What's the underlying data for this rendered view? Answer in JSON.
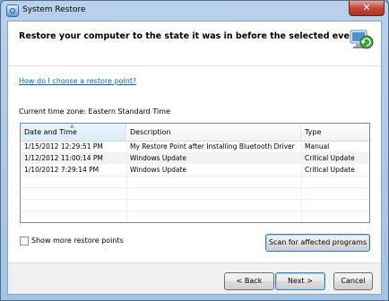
{
  "window": {
    "title": "System Restore",
    "close_glyph": "✕"
  },
  "header": {
    "title": "Restore your computer to the state it was in before the selected event",
    "icon": "system-restore-icon"
  },
  "help_link": "How do I choose a restore point?",
  "timezone_label": "Current time zone: Eastern Standard Time",
  "table": {
    "columns": [
      "Date and Time",
      "Description",
      "Type"
    ],
    "rows": [
      {
        "date": "1/15/2012 12:29:51 PM",
        "description": "My Restore Point after Installing Bluetooth Driver",
        "type": "Manual"
      },
      {
        "date": "1/12/2012 11:00:14 PM",
        "description": "Windows Update",
        "type": "Critical Update"
      },
      {
        "date": "1/10/2012 7:29:14 PM",
        "description": "Windows Update",
        "type": "Critical Update"
      }
    ]
  },
  "show_more": {
    "label": "Show more restore points",
    "checked": false
  },
  "buttons": {
    "scan": "Scan for affected programs",
    "back": "< Back",
    "next": "Next >",
    "cancel": "Cancel"
  }
}
